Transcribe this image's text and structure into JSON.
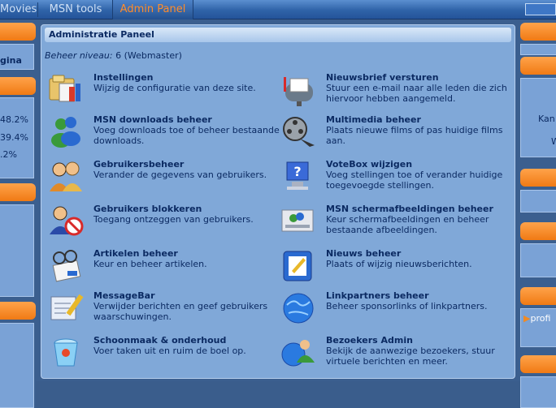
{
  "nav": {
    "tabs": [
      {
        "label": "Movies"
      },
      {
        "label": "MSN tools"
      },
      {
        "label": "Admin Panel",
        "active": true
      }
    ]
  },
  "left_sidebar": {
    "link": "gina",
    "stats": [
      "48.2%",
      "39.4%",
      ".2%"
    ]
  },
  "right_sidebar": {
    "text1": "Kan",
    "text2": "W",
    "text3": "profi"
  },
  "main": {
    "title": "Administratie Paneel",
    "level_label": "Beheer niveau:",
    "level_value": "6 (Webmaster)",
    "items_left": [
      {
        "title": "Instellingen",
        "desc": "Wijzig de configuratie van deze site.",
        "icon": "settings-icon"
      },
      {
        "title": "MSN downloads beheer",
        "desc": "Voeg downloads toe of beheer bestaande downloads.",
        "icon": "msn-buddies-icon"
      },
      {
        "title": "Gebruikersbeheer",
        "desc": "Verander de gegevens van gebruikers.",
        "icon": "users-icon"
      },
      {
        "title": "Gebruikers blokkeren",
        "desc": "Toegang ontzeggen van gebruikers.",
        "icon": "block-user-icon"
      },
      {
        "title": "Artikelen beheer",
        "desc": "Keur en beheer artikelen.",
        "icon": "articles-icon"
      },
      {
        "title": "MessageBar",
        "desc": "Verwijder berichten en geef gebruikers waarschuwingen.",
        "icon": "message-pencil-icon"
      },
      {
        "title": "Schoonmaak & onderhoud",
        "desc": "Voer taken uit en ruim de boel op.",
        "icon": "cleanup-bucket-icon"
      }
    ],
    "items_right": [
      {
        "title": "Nieuwsbrief versturen",
        "desc": "Stuur een e-mail naar alle leden die zich hiervoor hebben aangemeld.",
        "icon": "mailbox-icon"
      },
      {
        "title": "Multimedia beheer",
        "desc": "Plaats nieuwe films of pas huidige films aan.",
        "icon": "film-reel-icon"
      },
      {
        "title": "VoteBox wijzigen",
        "desc": "Voeg stellingen toe of verander huidige toegevoegde stellingen.",
        "icon": "votebox-help-icon"
      },
      {
        "title": "MSN schermafbeeldingen beheer",
        "desc": "Keur schermafbeeldingen en beheer bestaande afbeeldingen.",
        "icon": "screenshots-icon"
      },
      {
        "title": "Nieuws beheer",
        "desc": "Plaats of wijzig nieuwsberichten.",
        "icon": "news-edit-icon"
      },
      {
        "title": "Linkpartners beheer",
        "desc": "Beheer sponsorlinks of linkpartners.",
        "icon": "globe-icon"
      },
      {
        "title": "Bezoekers Admin",
        "desc": "Bekijk de aanwezige bezoekers, stuur virtuele berichten en meer.",
        "icon": "visitors-globe-icon"
      }
    ]
  }
}
